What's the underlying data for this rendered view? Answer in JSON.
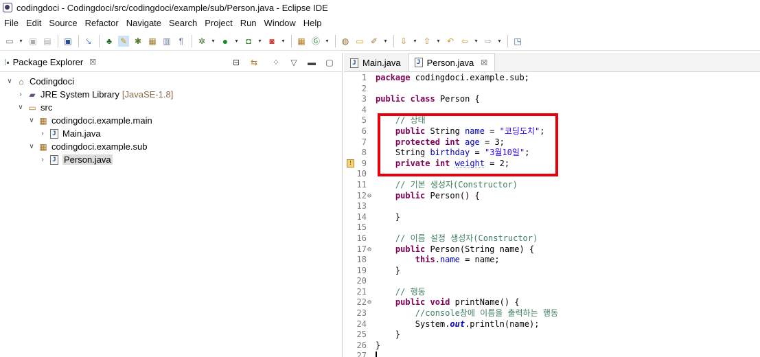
{
  "window": {
    "title": "codingdoci - Codingdoci/src/codingdoci/example/sub/Person.java - Eclipse IDE"
  },
  "menu": [
    "File",
    "Edit",
    "Source",
    "Refactor",
    "Navigate",
    "Search",
    "Project",
    "Run",
    "Window",
    "Help"
  ],
  "package_explorer": {
    "title": "Package Explorer",
    "close": "☒",
    "tree": [
      {
        "indent": 0,
        "twist": "∨",
        "icon": "project-icon",
        "label": "Codingdoci",
        "extra": ""
      },
      {
        "indent": 1,
        "twist": "›",
        "icon": "library-icon",
        "label": "JRE System Library",
        "extra": "[JavaSE-1.8]"
      },
      {
        "indent": 1,
        "twist": "∨",
        "icon": "source-folder-icon",
        "label": "src",
        "extra": ""
      },
      {
        "indent": 2,
        "twist": "∨",
        "icon": "package-icon",
        "label": "codingdoci.example.main",
        "extra": ""
      },
      {
        "indent": 3,
        "twist": "›",
        "icon": "java-file-icon",
        "label": "Main.java",
        "extra": ""
      },
      {
        "indent": 2,
        "twist": "∨",
        "icon": "package-icon",
        "label": "codingdoci.example.sub",
        "extra": ""
      },
      {
        "indent": 3,
        "twist": "›",
        "icon": "java-file-icon",
        "label": "Person.java",
        "extra": "",
        "selected": true
      }
    ]
  },
  "editor": {
    "tabs": [
      {
        "label": "Main.java",
        "active": false
      },
      {
        "label": "Person.java",
        "active": true,
        "close": "☒"
      }
    ],
    "lines": [
      {
        "n": "1",
        "html": "<span class='kw'>package</span> codingdoci.example.sub;"
      },
      {
        "n": "2",
        "html": ""
      },
      {
        "n": "3",
        "html": "<span class='kw'>public</span> <span class='kw'>class</span> Person {"
      },
      {
        "n": "4",
        "html": ""
      },
      {
        "n": "5",
        "html": "    <span class='cmt'>// 상태</span>"
      },
      {
        "n": "6",
        "html": "    <span class='kw'>public</span> String <span class='fld'>name</span> = <span class='str'>\"코딩도치\"</span>;"
      },
      {
        "n": "7",
        "html": "    <span class='kw'>protected</span> <span class='kw'>int</span> <span class='fld'>age</span> = 3;"
      },
      {
        "n": "8",
        "html": "    String <span class='fld'>birthday</span> = <span class='str'>\"3월10일\"</span>;"
      },
      {
        "n": "9",
        "html": "    <span class='kw'>private</span> <span class='kw'>int</span> <span class='fld dotted'>weight</span> = 2;",
        "marker": "warning"
      },
      {
        "n": "10",
        "html": ""
      },
      {
        "n": "11",
        "html": "    <span class='cmt'>// 기본 생성자(Constructor)</span>"
      },
      {
        "n": "12",
        "html": "    <span class='kw'>public</span> Person() {",
        "fold": "⊖"
      },
      {
        "n": "13",
        "html": ""
      },
      {
        "n": "14",
        "html": "    }"
      },
      {
        "n": "15",
        "html": ""
      },
      {
        "n": "16",
        "html": "    <span class='cmt'>// 이름 설정 생성자(Constructor)</span>"
      },
      {
        "n": "17",
        "html": "    <span class='kw'>public</span> Person(String name) {",
        "fold": "⊖"
      },
      {
        "n": "18",
        "html": "        <span class='kw'>this</span>.<span class='fld'>name</span> = name;"
      },
      {
        "n": "19",
        "html": "    }"
      },
      {
        "n": "20",
        "html": ""
      },
      {
        "n": "21",
        "html": "    <span class='cmt'>// 행동</span>"
      },
      {
        "n": "22",
        "html": "    <span class='kw'>public</span> <span class='kw'>void</span> printName() {",
        "fold": "⊖"
      },
      {
        "n": "23",
        "html": "        <span class='cmt'>//console창에 이름을 출력하는 행동</span>"
      },
      {
        "n": "24",
        "html": "        System.<span class='stat'>out</span>.println(name);"
      },
      {
        "n": "25",
        "html": "    }"
      },
      {
        "n": "26",
        "html": "}"
      },
      {
        "n": "27",
        "html": ""
      }
    ]
  },
  "colors": {
    "highlight_box": "#e8000a",
    "keyword": "#7f0055",
    "field": "#0000c0",
    "string": "#2a00ff",
    "comment": "#3f7f5f"
  }
}
